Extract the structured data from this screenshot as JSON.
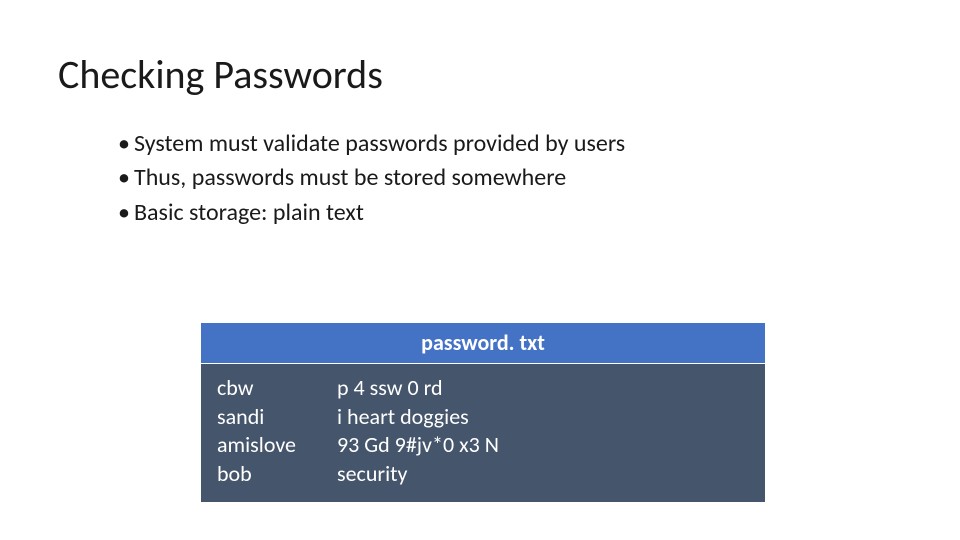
{
  "title": "Checking Passwords",
  "bullets": [
    "System must validate passwords provided by users",
    "Thus, passwords must be stored somewhere",
    "Basic storage: plain text"
  ],
  "file": {
    "name": "password. txt",
    "rows": [
      {
        "user": "cbw",
        "password": "p 4 ssw 0 rd"
      },
      {
        "user": "sandi",
        "password": "i heart doggies"
      },
      {
        "user": "amislove",
        "password": "93 Gd 9#jv*0 x3 N"
      },
      {
        "user": "bob",
        "password": "security"
      }
    ]
  }
}
